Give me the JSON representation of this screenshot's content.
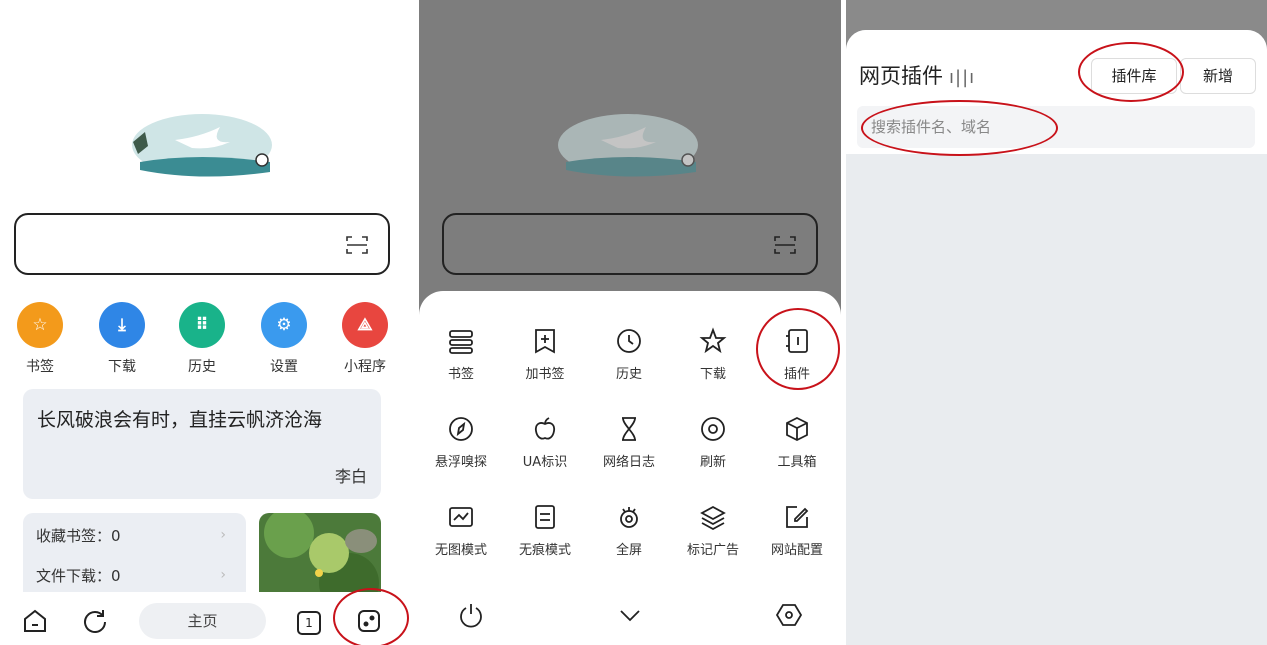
{
  "panel1": {
    "scan_icon": "scan-icon",
    "quick_links": [
      {
        "label": "书签",
        "icon": "star-icon",
        "color": "#f39a1b",
        "glyph": "☆"
      },
      {
        "label": "下载",
        "icon": "download-icon",
        "color": "#2f86e6",
        "glyph": "⤓"
      },
      {
        "label": "历史",
        "icon": "footprints-icon",
        "color": "#19b38a",
        "glyph": "⠿"
      },
      {
        "label": "设置",
        "icon": "gear-icon",
        "color": "#3a9aee",
        "glyph": "⚙"
      },
      {
        "label": "小程序",
        "icon": "miniapp-icon",
        "color": "#e8463f",
        "glyph": "⟁"
      }
    ],
    "quote": {
      "text": "长风破浪会有时，直挂云帆济沧海",
      "author": "李白"
    },
    "stats": [
      {
        "label": "收藏书签：0"
      },
      {
        "label": "文件下载：0"
      }
    ],
    "bottom": {
      "home_label": "主页",
      "tab_count": "1"
    }
  },
  "panel2": {
    "menu": [
      {
        "label": "书签",
        "icon": "bookmarks-icon"
      },
      {
        "label": "加书签",
        "icon": "add-bookmark-icon"
      },
      {
        "label": "历史",
        "icon": "clock-icon"
      },
      {
        "label": "下载",
        "icon": "star-outline-icon"
      },
      {
        "label": "插件",
        "icon": "plugin-icon"
      },
      {
        "label": "悬浮嗅探",
        "icon": "compass-icon"
      },
      {
        "label": "UA标识",
        "icon": "apple-icon"
      },
      {
        "label": "网络日志",
        "icon": "hourglass-icon"
      },
      {
        "label": "刷新",
        "icon": "refresh-target-icon"
      },
      {
        "label": "工具箱",
        "icon": "cube-icon"
      },
      {
        "label": "无图模式",
        "icon": "image-off-icon"
      },
      {
        "label": "无痕模式",
        "icon": "document-icon"
      },
      {
        "label": "全屏",
        "icon": "eye-icon"
      },
      {
        "label": "标记广告",
        "icon": "layers-icon"
      },
      {
        "label": "网站配置",
        "icon": "edit-icon"
      }
    ]
  },
  "panel3": {
    "title": "网页插件",
    "bars": "ı||ı",
    "library_button": "插件库",
    "add_button": "新增",
    "search_placeholder": "搜索插件名、域名"
  }
}
